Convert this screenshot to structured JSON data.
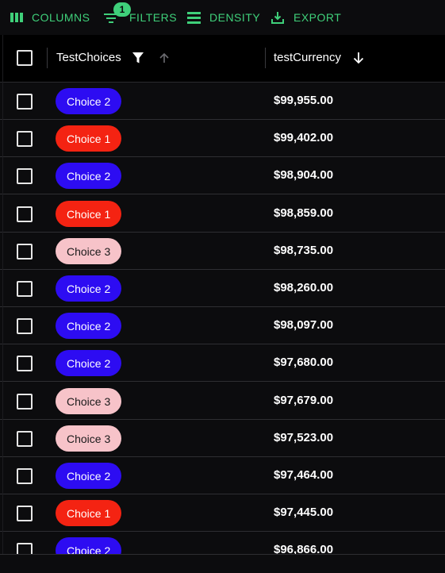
{
  "toolbar": {
    "columns_label": "Columns",
    "filters_label": "Filters",
    "filters_badge": "1",
    "density_label": "Density",
    "export_label": "Export"
  },
  "header": {
    "col1_title": "TestChoices",
    "col2_title": "testCurrency"
  },
  "choice_colors": {
    "Choice 1": {
      "bg": "#f42312",
      "fg": "#ffffff"
    },
    "Choice 2": {
      "bg": "#2d0cf2",
      "fg": "#ffffff"
    },
    "Choice 3": {
      "bg": "#f7c3c9",
      "fg": "#1a1a1a"
    }
  },
  "rows": [
    {
      "choice": "Choice 2",
      "currency": "$99,955.00"
    },
    {
      "choice": "Choice 1",
      "currency": "$99,402.00"
    },
    {
      "choice": "Choice 2",
      "currency": "$98,904.00"
    },
    {
      "choice": "Choice 1",
      "currency": "$98,859.00"
    },
    {
      "choice": "Choice 3",
      "currency": "$98,735.00"
    },
    {
      "choice": "Choice 2",
      "currency": "$98,260.00"
    },
    {
      "choice": "Choice 2",
      "currency": "$98,097.00"
    },
    {
      "choice": "Choice 2",
      "currency": "$97,680.00"
    },
    {
      "choice": "Choice 3",
      "currency": "$97,679.00"
    },
    {
      "choice": "Choice 3",
      "currency": "$97,523.00"
    },
    {
      "choice": "Choice 2",
      "currency": "$97,464.00"
    },
    {
      "choice": "Choice 1",
      "currency": "$97,445.00"
    },
    {
      "choice": "Choice 2",
      "currency": "$96,866.00"
    }
  ]
}
